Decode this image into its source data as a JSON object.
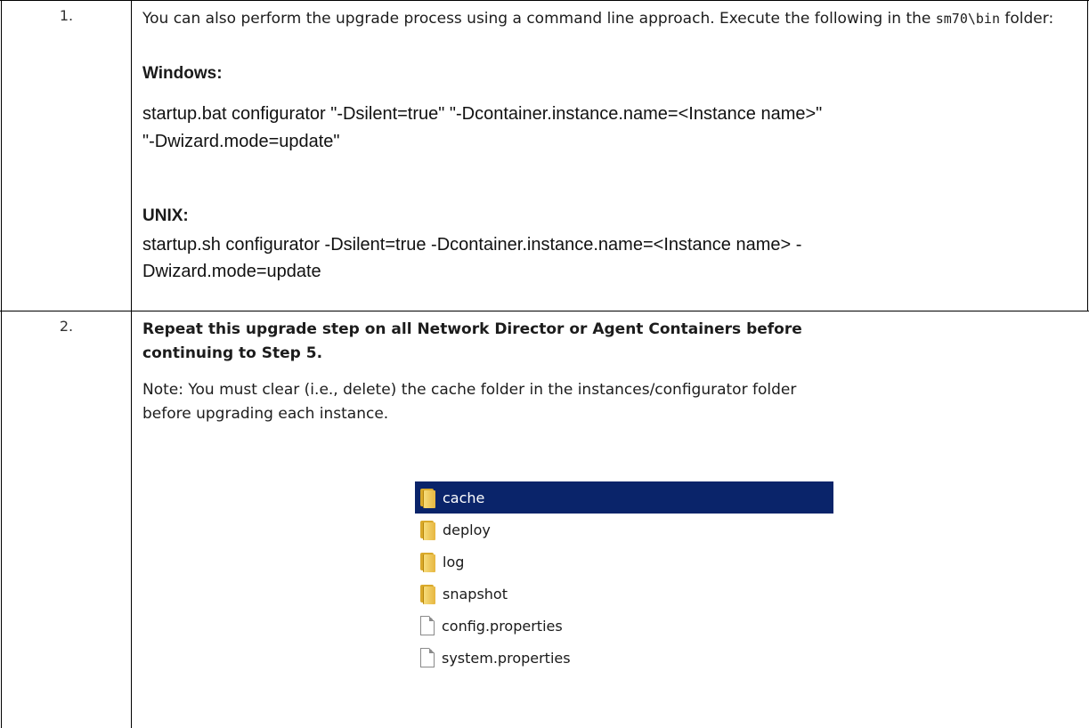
{
  "steps": [
    {
      "number": "1.",
      "intro_prefix": "You can also perform the upgrade process using a command line approach. Execute the following in the ",
      "intro_code": "sm70\\bin",
      "intro_suffix": " folder:",
      "windows_heading": "Windows:",
      "windows_cmd_line1": "startup.bat configurator \"-Dsilent=true\" \"-Dcontainer.instance.name=<Instance name>\"",
      "windows_cmd_line2": "\"-Dwizard.mode=update\"",
      "unix_heading": "UNIX:",
      "unix_cmd_line1": "startup.sh configurator -Dsilent=true -Dcontainer.instance.name=<Instance name> -",
      "unix_cmd_line2": "Dwizard.mode=update"
    },
    {
      "number": "2.",
      "bold_line1": "Repeat this upgrade step on all Network Director or Agent Containers before",
      "bold_line2": "continuing to Step 5.",
      "note_line1": "Note: You must clear (i.e., delete) the cache folder in the instances/configurator folder",
      "note_line2": "before upgrading each instance."
    }
  ],
  "explorer": {
    "items": [
      {
        "name": "cache",
        "type": "folder",
        "selected": true
      },
      {
        "name": "deploy",
        "type": "folder",
        "selected": false
      },
      {
        "name": "log",
        "type": "folder",
        "selected": false
      },
      {
        "name": "snapshot",
        "type": "folder",
        "selected": false
      },
      {
        "name": "config.properties",
        "type": "file",
        "selected": false
      },
      {
        "name": "system.properties",
        "type": "file",
        "selected": false
      }
    ],
    "selection_color": "#0a246a"
  }
}
